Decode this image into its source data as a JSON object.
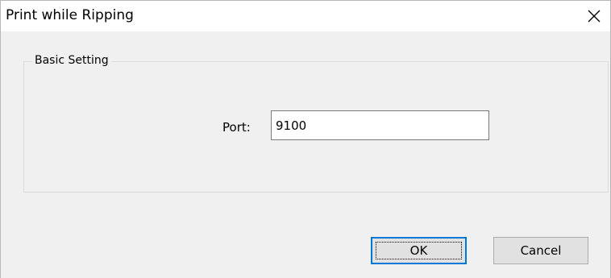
{
  "dialog": {
    "title": "Print while Ripping"
  },
  "basic_setting": {
    "legend": "Basic Setting",
    "port_label": "Port:",
    "port_value": "9100"
  },
  "buttons": {
    "ok_label": "OK",
    "cancel_label": "Cancel"
  },
  "icons": {
    "close": "close-icon"
  },
  "colors": {
    "client_background": "#f0f0f0",
    "focus_border": "#0078d7"
  }
}
